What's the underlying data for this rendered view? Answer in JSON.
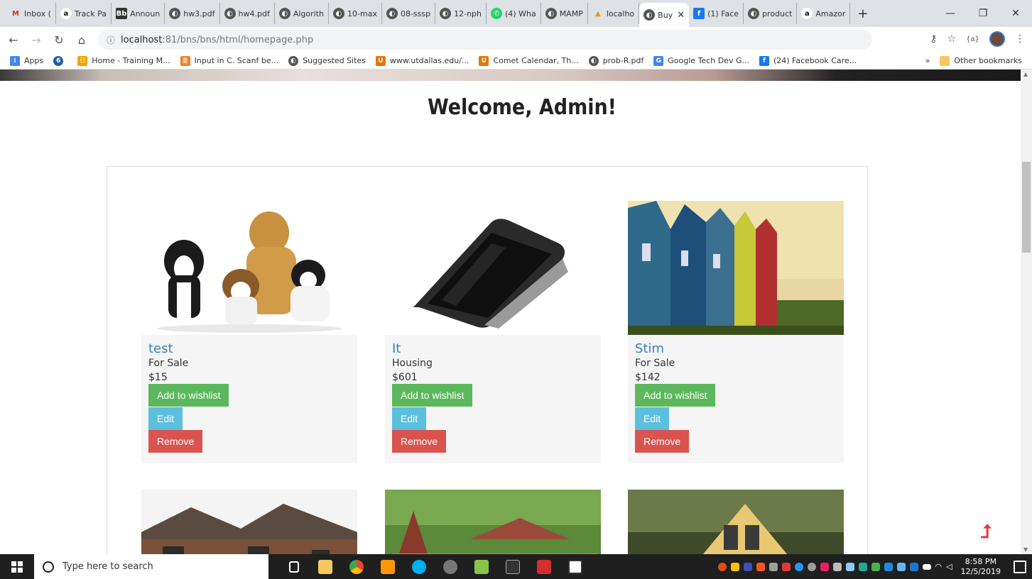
{
  "tabs": [
    {
      "label": "Inbox (",
      "icon": "gmail-icon",
      "color": "#d93025"
    },
    {
      "label": "Track Pa",
      "icon": "amazon-icon",
      "color": "#111111"
    },
    {
      "label": "Announ",
      "icon": "bb-icon",
      "color": "#333333"
    },
    {
      "label": "hw3.pdf",
      "icon": "globe-icon",
      "color": "#555555"
    },
    {
      "label": "hw4.pdf",
      "icon": "globe-icon",
      "color": "#555555"
    },
    {
      "label": "Algorith",
      "icon": "globe-icon",
      "color": "#555555"
    },
    {
      "label": "10-max",
      "icon": "globe-icon",
      "color": "#555555"
    },
    {
      "label": "08-sssp",
      "icon": "globe-icon",
      "color": "#555555"
    },
    {
      "label": "12-nph",
      "icon": "globe-icon",
      "color": "#555555"
    },
    {
      "label": "(4) Wha",
      "icon": "whatsapp-icon",
      "color": "#25d366"
    },
    {
      "label": "MAMP",
      "icon": "globe-icon",
      "color": "#555555"
    },
    {
      "label": "localho",
      "icon": "phpmyadmin-icon",
      "color": "#f29111"
    },
    {
      "label": "Buy",
      "icon": "globe-icon",
      "color": "#555555",
      "active": true
    },
    {
      "label": "(1) Face",
      "icon": "facebook-icon",
      "color": "#1877f2"
    },
    {
      "label": "product",
      "icon": "globe-icon",
      "color": "#555555"
    },
    {
      "label": "Amazor",
      "icon": "amazon-icon",
      "color": "#111111"
    }
  ],
  "address": {
    "host": "localhost",
    "path": ":81/bns/bns/html/homepage.php"
  },
  "bookmarks": [
    {
      "label": "Apps",
      "color": "#4285f4"
    },
    {
      "label": "",
      "color": "#1e5fa8"
    },
    {
      "label": "Home - Training M...",
      "color": "#f4a300"
    },
    {
      "label": "Input in C. Scanf be...",
      "color": "#f48024"
    },
    {
      "label": "Suggested Sites",
      "color": "#555555"
    },
    {
      "label": "www.utdallas.edu/...",
      "color": "#e87500"
    },
    {
      "label": "Comet Calendar, Th...",
      "color": "#e87500"
    },
    {
      "label": "prob-R.pdf",
      "color": "#555555"
    },
    {
      "label": "Google Tech Dev G...",
      "color": "#4285f4"
    },
    {
      "label": "(24) Facebook Care...",
      "color": "#1877f2"
    }
  ],
  "bookmarks_more": "»",
  "other_bookmarks": "Other bookmarks",
  "page": {
    "welcome": "Welcome, Admin!"
  },
  "products": [
    {
      "name": "test",
      "category": "For Sale",
      "price": "$15",
      "wishlist": "Add to wishlist",
      "edit": "Edit",
      "remove": "Remove"
    },
    {
      "name": "It",
      "category": "Housing",
      "price": "$601",
      "wishlist": "Add to wishlist",
      "edit": "Edit",
      "remove": "Remove"
    },
    {
      "name": "Stim",
      "category": "For Sale",
      "price": "$142",
      "wishlist": "Add to wishlist",
      "edit": "Edit",
      "remove": "Remove"
    }
  ],
  "taskbar": {
    "search_placeholder": "Type here to search",
    "time": "8:58 PM",
    "date": "12/5/2019"
  }
}
